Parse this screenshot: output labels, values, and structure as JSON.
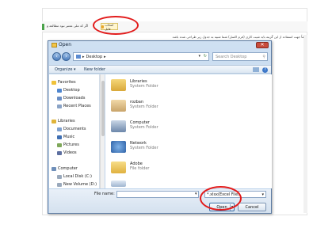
{
  "background": {
    "link_text": "اگر کد ملی معتبر نبود مطالعه و",
    "pick_file_button": "انتخاب فایل",
    "instructions": "لطفاً جهت استفاده از این گزینه باید شیت کاری (فرم اکسل) شما شبیه به جدول زیر طراحی شده باشد"
  },
  "dialog": {
    "title": "Open",
    "close_label": "✕",
    "address": "Desktop",
    "search_placeholder": "Search Desktop",
    "organize_label": "Organize ▾",
    "new_folder_label": "New folder",
    "nav_pane": {
      "favorites_label": "Favorites",
      "favorites": [
        "Desktop",
        "Downloads",
        "Recent Places"
      ],
      "libraries_label": "Libraries",
      "libraries": [
        "Documents",
        "Music",
        "Pictures",
        "Videos"
      ],
      "computer_label": "Computer",
      "drives": [
        "Local Disk (C:)",
        "New Volume (D:)"
      ]
    },
    "files": [
      {
        "name": "Libraries",
        "type": "System Folder"
      },
      {
        "name": "rozban",
        "type": "System Folder"
      },
      {
        "name": "Computer",
        "type": "System Folder"
      },
      {
        "name": "Network",
        "type": "System Folder"
      },
      {
        "name": "Adobe",
        "type": "File folder"
      }
    ],
    "file_name_label": "File name:",
    "file_name_value": "",
    "file_type_value": "*.xlsx(Excel File)",
    "open_label": "Open",
    "cancel_label": "Cancel"
  },
  "colors": {
    "highlight": "#e21b1b"
  }
}
